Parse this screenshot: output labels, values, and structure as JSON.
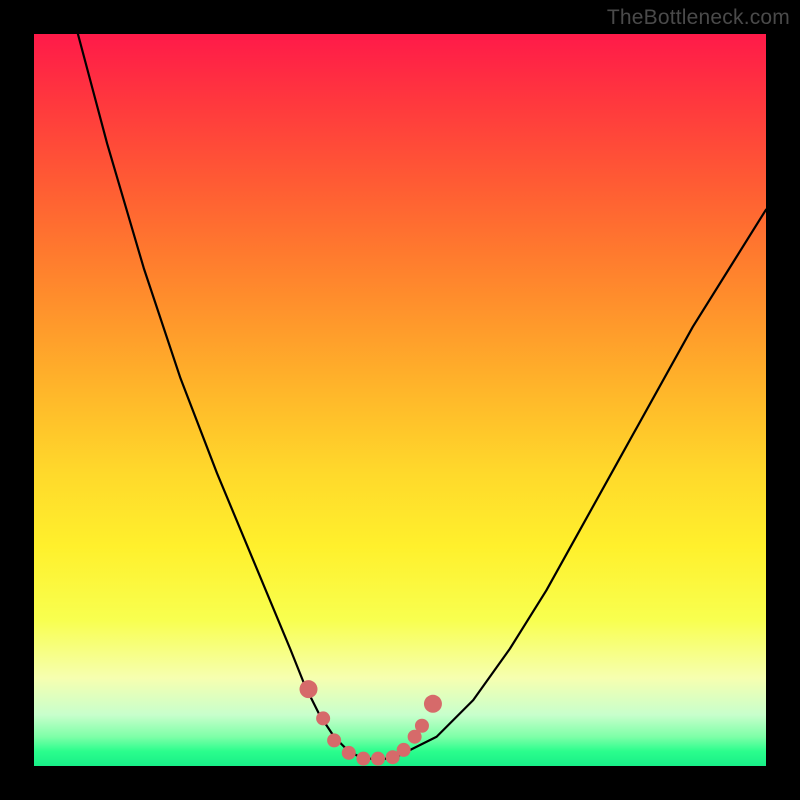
{
  "watermark": "TheBottleneck.com",
  "chart_data": {
    "type": "line",
    "title": "",
    "xlabel": "",
    "ylabel": "",
    "xlim": [
      0,
      100
    ],
    "ylim": [
      0,
      100
    ],
    "grid": false,
    "series": [
      {
        "name": "curve",
        "x": [
          6,
          10,
          15,
          20,
          25,
          30,
          35,
          37,
          39,
          41,
          43,
          45,
          47,
          49,
          51,
          55,
          60,
          65,
          70,
          75,
          80,
          85,
          90,
          95,
          100
        ],
        "values": [
          100,
          85,
          68,
          53,
          40,
          28,
          16,
          11,
          7,
          4,
          2,
          1,
          1,
          1,
          2,
          4,
          9,
          16,
          24,
          33,
          42,
          51,
          60,
          68,
          76
        ]
      }
    ],
    "markers": {
      "name": "highlight-dots",
      "color": "#d66a6a",
      "radius_large": 9,
      "radius_small": 7,
      "x": [
        37.5,
        39.5,
        41,
        43,
        45,
        47,
        49,
        50.5,
        52,
        53,
        54.5
      ],
      "values": [
        10.5,
        6.5,
        3.5,
        1.8,
        1.0,
        1.0,
        1.2,
        2.2,
        4.0,
        5.5,
        8.5
      ]
    }
  }
}
